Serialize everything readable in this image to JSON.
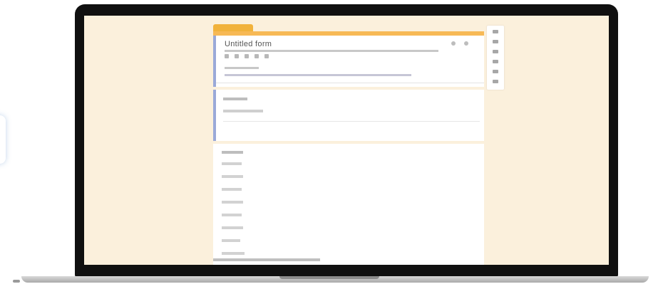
{
  "form": {
    "title": "Untitled form",
    "sections": [
      {
        "question": ""
      }
    ],
    "list_items_count": 9
  },
  "colors": {
    "screen_background": "#fbf0dc",
    "accent": "#f7b955",
    "section_border": "#9aa9d8",
    "laptop_bezel": "#101010"
  },
  "icons": {
    "header": [
      "copy-icon",
      "more-icon"
    ],
    "sidebar": [
      "add-question-icon",
      "import-icon",
      "title-icon",
      "image-icon",
      "video-icon",
      "section-icon"
    ],
    "left_pill": "chevron-icon"
  }
}
